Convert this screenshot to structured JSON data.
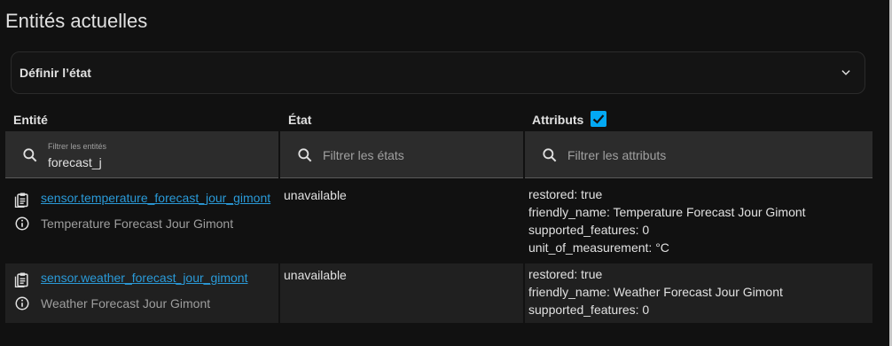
{
  "page_title": "Entités actuelles",
  "expander": {
    "label": "Définir l’état"
  },
  "columns": {
    "entity": "Entité",
    "state": "État",
    "attributes": "Attributs",
    "attributes_checked": true
  },
  "filters": {
    "entity": {
      "label": "Filtrer les entités",
      "value": "forecast_j"
    },
    "state": {
      "placeholder": "Filtrer les états"
    },
    "attributes": {
      "placeholder": "Filtrer les attributs"
    }
  },
  "rows": [
    {
      "entity_id": "sensor.temperature_forecast_jour_gimont",
      "friendly_name": "Temperature Forecast Jour Gimont",
      "state": "unavailable",
      "attributes": [
        "restored: true",
        "friendly_name: Temperature Forecast Jour Gimont",
        "supported_features: 0",
        "unit_of_measurement: °C"
      ]
    },
    {
      "entity_id": "sensor.weather_forecast_jour_gimont",
      "friendly_name": "Weather Forecast Jour Gimont",
      "state": "unavailable",
      "attributes": [
        "restored: true",
        "friendly_name: Weather Forecast Jour Gimont",
        "supported_features: 0"
      ]
    }
  ],
  "colors": {
    "accent": "#03a9f4",
    "link": "#2a9ad8",
    "background": "#111111",
    "header_bg": "#2c2c2c"
  },
  "icons": {
    "search": "search-icon",
    "copy": "clipboard-icon",
    "info": "info-icon",
    "expand": "chevron-down-icon",
    "check": "checkbox-checked-icon"
  }
}
